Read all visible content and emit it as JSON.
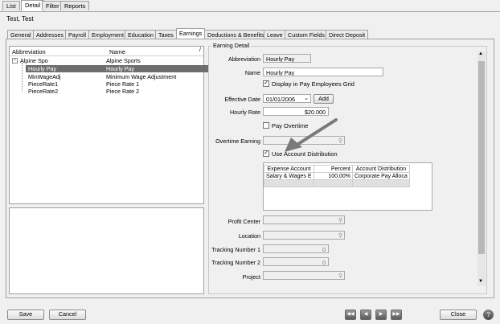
{
  "top_tabs": [
    "List",
    "Detail",
    "Filter",
    "Reports"
  ],
  "record_title": "Test, Test",
  "sub_tabs": [
    "General",
    "Addresses",
    "Payroll",
    "Employment",
    "Education",
    "Taxes",
    "Earnings",
    "Deductions & Benefits",
    "Leave",
    "Custom Fields",
    "Direct Deposit"
  ],
  "tree": {
    "col_abbrev": "Abbreviation",
    "col_name": "Name",
    "rows": [
      {
        "abbrev": "Alpine Spo",
        "name": "Alpine Sports"
      },
      {
        "abbrev": "Hourly Pay",
        "name": "Hourly Pay"
      },
      {
        "abbrev": "MinWageAdj",
        "name": "Minimum Wage Adjustment"
      },
      {
        "abbrev": "PieceRate1",
        "name": "Piece Rate 1"
      },
      {
        "abbrev": "PieceRate2",
        "name": "Piece Rate 2"
      }
    ]
  },
  "detail": {
    "section_title": "Earning Detail",
    "abbrev_label": "Abbreviation",
    "abbrev_value": "Hourly Pay",
    "name_label": "Name",
    "name_value": "Hourly Pay",
    "display_grid_label": "Display in Pay Employees Grid",
    "eff_date_label": "Effective Date",
    "eff_date_value": "01/01/2006",
    "add_label": "Add",
    "rate_label": "Hourly Rate",
    "rate_value": "$20.000",
    "pay_overtime_label": "Pay Overtime",
    "ot_label": "Overtime Earning",
    "use_acct_label": "Use Account Distribution",
    "grid_headers": [
      "Expense Account",
      "Percent",
      "Account Distribution"
    ],
    "grid_row": [
      "Salary & Wages E",
      "100.00%",
      "Corporate Pay Alloca"
    ],
    "profit_label": "Profit Center",
    "location_label": "Location",
    "track1_label": "Tracking Number 1",
    "track1_value": "0",
    "track2_label": "Tracking Number 2",
    "track2_value": "0",
    "project_label": "Project"
  },
  "footer": {
    "save": "Save",
    "cancel": "Cancel",
    "close": "Close",
    "help": "?"
  },
  "icons": {
    "first": "first-record-icon",
    "prev": "prev-record-icon",
    "next": "next-record-icon",
    "last": "last-record-icon"
  }
}
